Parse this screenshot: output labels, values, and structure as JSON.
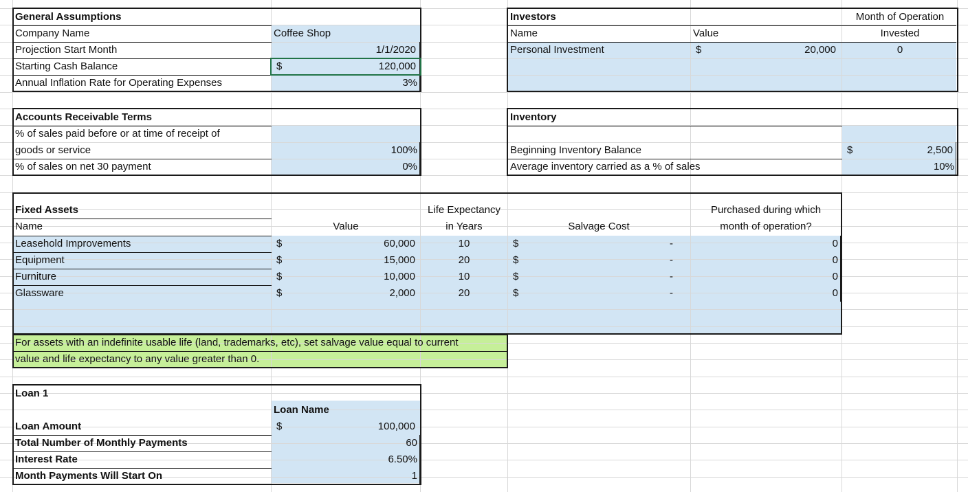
{
  "general": {
    "title": "General Assumptions",
    "company_label": "Company Name",
    "company_value": "Coffee Shop",
    "start_label": "Projection Start Month",
    "start_value": "1/1/2020",
    "cash_label": "Starting Cash Balance",
    "cash_currency": "$",
    "cash_value": "120,000",
    "inflation_label": "Annual Inflation Rate for Operating Expenses",
    "inflation_value": "3%"
  },
  "investors": {
    "title": "Investors",
    "col_name": "Name",
    "col_value": "Value",
    "col_month_line1": "Month of Operation",
    "col_month_line2": "Invested",
    "row_name": "Personal Investment",
    "row_currency": "$",
    "row_value": "20,000",
    "row_month": "0"
  },
  "ar": {
    "title": "Accounts Receivable Terms",
    "paid_label_line1": "% of sales paid before or at time of receipt of",
    "paid_label_line2": "goods or service",
    "paid_value": "100%",
    "net30_label": "% of sales on net 30 payment",
    "net30_value": "0%"
  },
  "inventory": {
    "title": "Inventory",
    "beginning_label": "Beginning Inventory Balance",
    "beginning_currency": "$",
    "beginning_value": "2,500",
    "avg_label": "Average inventory carried as a % of sales",
    "avg_value": "10%"
  },
  "fixed_assets": {
    "title": "Fixed Assets",
    "col_name": "Name",
    "col_value": "Value",
    "col_life_line1": "Life Expectancy",
    "col_life_line2": "in Years",
    "col_salvage": "Salvage Cost",
    "col_month_line1": "Purchased during which",
    "col_month_line2": "month of operation?",
    "rows": [
      {
        "name": "Leasehold Improvements",
        "currency": "$",
        "value": "60,000",
        "life": "10",
        "salvage_currency": "$",
        "salvage": "-",
        "month": "0"
      },
      {
        "name": "Equipment",
        "currency": "$",
        "value": "15,000",
        "life": "20",
        "salvage_currency": "$",
        "salvage": "-",
        "month": "0"
      },
      {
        "name": "Furniture",
        "currency": "$",
        "value": "10,000",
        "life": "10",
        "salvage_currency": "$",
        "salvage": "-",
        "month": "0"
      },
      {
        "name": "Glassware",
        "currency": "$",
        "value": "2,000",
        "life": "20",
        "salvage_currency": "$",
        "salvage": "-",
        "month": "0"
      }
    ],
    "note_line1": "For assets with an indefinite usable life (land, trademarks, etc), set salvage value equal to current",
    "note_line2": "value and life expectancy to any value greater than 0."
  },
  "loan": {
    "title": "Loan 1",
    "name_header": "Loan Name",
    "amount_label": "Loan Amount",
    "amount_currency": "$",
    "amount_value": "100,000",
    "payments_label": "Total Number of Monthly Payments",
    "payments_value": "60",
    "rate_label": "Interest Rate",
    "rate_value": "6.50%",
    "start_label": "Month Payments Will Start On",
    "start_value": "1"
  }
}
